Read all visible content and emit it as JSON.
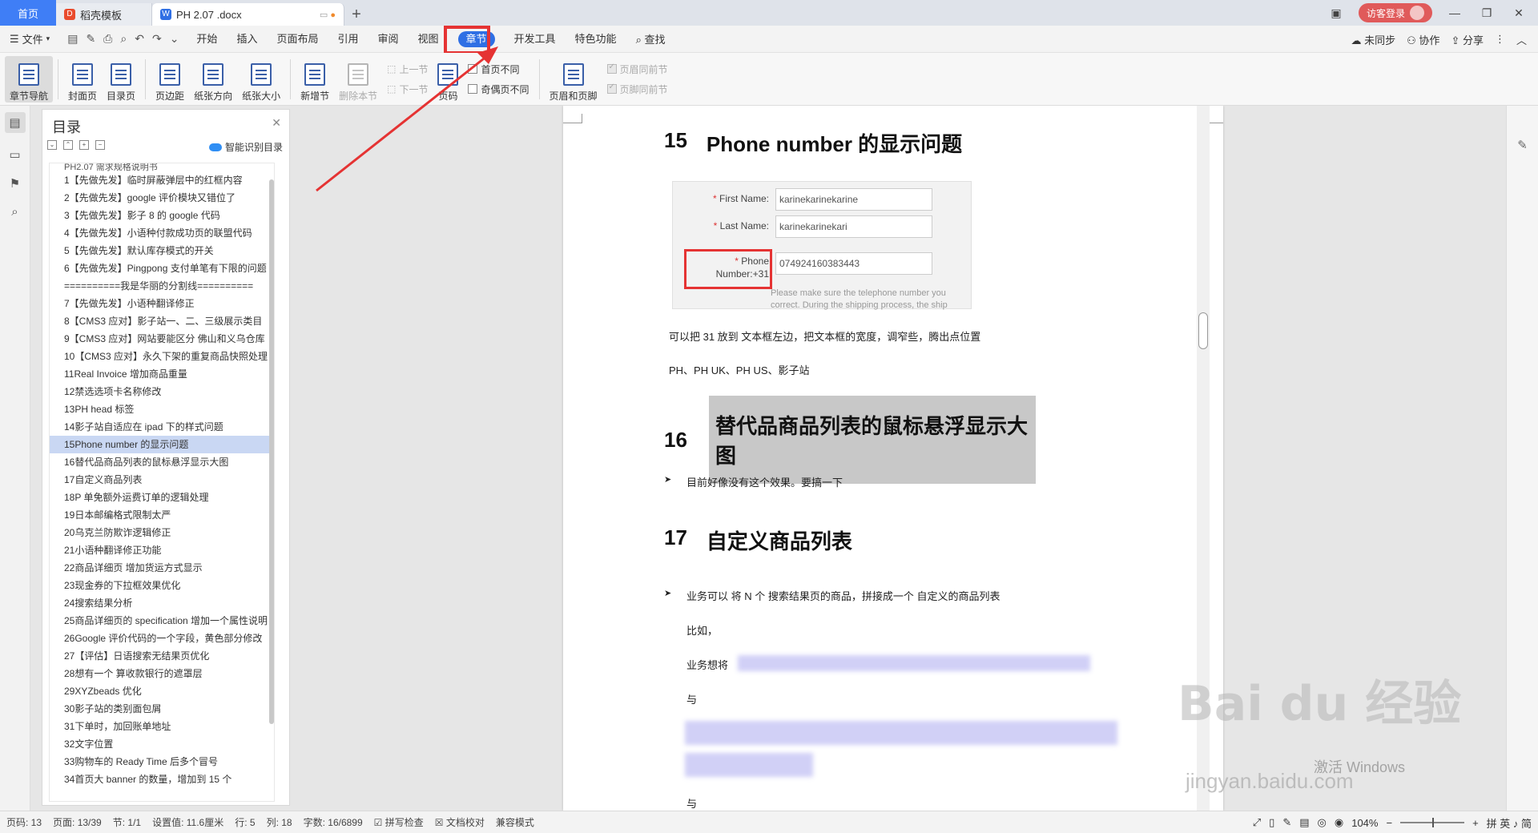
{
  "titlebar": {
    "tabs": {
      "home": "首页",
      "template": "稻壳模板",
      "doc": "PH 2.07 .docx"
    },
    "guest_login": "访客登录"
  },
  "menubar": {
    "file": "文件",
    "items": [
      "开始",
      "插入",
      "页面布局",
      "引用",
      "审阅",
      "视图",
      "章节",
      "开发工具",
      "特色功能"
    ],
    "search": "查找",
    "right": {
      "sync": "未同步",
      "collab": "协作",
      "share": "分享"
    }
  },
  "ribbon": {
    "nav": "章节导航",
    "cover": "封面页",
    "toc_page": "目录页",
    "margins": "页边距",
    "orientation": "纸张方向",
    "size": "纸张大小",
    "new_section": "新增节",
    "delete_section": "删除本节",
    "prev_section": "上一节",
    "next_section": "下一节",
    "page_number": "页码",
    "first_page_diff": "首页不同",
    "odd_even_diff": "奇偶页不同",
    "header_footer": "页眉和页脚",
    "header_same": "页眉同前节",
    "footer_same": "页脚同前节"
  },
  "toc": {
    "title": "目录",
    "smart": "智能识别目录",
    "partial_top": "PH2.07 需求规格说明书",
    "items": [
      "1【先做先发】临时屏蔽弹层中的红框内容",
      "2【先做先发】google 评价模块又错位了",
      "3【先做先发】影子 8 的 google 代码",
      "4【先做先发】小语种付款成功页的联盟代码",
      "5【先做先发】默认库存模式的开关",
      "6【先做先发】Pingpong 支付单笔有下限的问题",
      "==========我是华丽的分割线==========",
      "7【先做先发】小语种翻译修正",
      "8【CMS3 应对】影子站一、二、三级展示类目",
      "9【CMS3 应对】网站要能区分 佛山和义乌仓库",
      "10【CMS3 应对】永久下架的重复商品快照处理",
      "11Real Invoice 增加商品重量",
      "12禁选选项卡名称修改",
      "13PH head 标签",
      "14影子站自适应在 ipad 下的样式问题",
      "15Phone number 的显示问题",
      "16替代品商品列表的鼠标悬浮显示大图",
      "17自定义商品列表",
      "18P 单免额外运费订单的逻辑处理",
      "19日本邮编格式限制太严",
      "20乌克兰防欺诈逻辑修正",
      "21小语种翻译修正功能",
      "22商品详细页 增加货运方式显示",
      "23现金券的下拉框效果优化",
      "24搜索结果分析",
      "25商品详细页的 specification 增加一个属性说明",
      "26Google 评价代码的一个字段，黄色部分修改",
      "27【评估】日语搜索无结果页优化",
      "28想有一个 算收款银行的遮罩层",
      "29XYZbeads 优化",
      "30影子站的类别面包屑",
      "31下单时，加回账单地址",
      "32文字位置",
      "33购物车的 Ready Time 后多个冒号",
      "34首页大 banner 的数量，增加到 15 个"
    ],
    "current_index": 15
  },
  "doc": {
    "h15_num": "15",
    "h15_text": "Phone number 的显示问题",
    "form": {
      "first_name_label": "First Name:",
      "first_name_value": "karinekarinekarine",
      "last_name_label": "Last Name:",
      "last_name_value": "karinekarinekari",
      "phone_label_1": "Phone",
      "phone_label_2": "Number:+31",
      "phone_value": "074924160383443",
      "hint_1": "Please make sure the telephone number you",
      "hint_2": "correct. During the shipping process, the ship",
      "req_mark": "*"
    },
    "p1": "可以把 31 放到 文本框左边，把文本框的宽度，调窄些，腾出点位置",
    "p2": "PH、PH UK、PH US、影子站",
    "h16_num": "16",
    "h16_text": "替代品商品列表的鼠标悬浮显示大图",
    "p3": "目前好像没有这个效果。要搞一下",
    "h17_num": "17",
    "h17_text": "自定义商品列表",
    "p4": "业务可以 将 N 个 搜索结果页的商品，拼接成一个 自定义的商品列表",
    "p5": "比如，",
    "p6": "业务想将",
    "p7": "与",
    "p8": "与"
  },
  "watermark": {
    "brand": "Bai  du 经验",
    "sub": "jingyan.baidu.com",
    "activate": "激活 Windows"
  },
  "statusbar": {
    "page_code": "页码: 13",
    "page": "页面: 13/39",
    "section": "节: 1/1",
    "setting": "设置值: 11.6厘米",
    "row": "行: 5",
    "col": "列: 18",
    "chars": "字数: 16/6899",
    "spell": "拼写检查",
    "proof": "文档校对",
    "compat": "兼容模式",
    "zoom": "104%",
    "ime": "拼 英 ♪ 简"
  },
  "colors": {
    "accent": "#2f6fe4",
    "highlight_red": "#e53333",
    "toc_current": "#c9d7f3"
  }
}
